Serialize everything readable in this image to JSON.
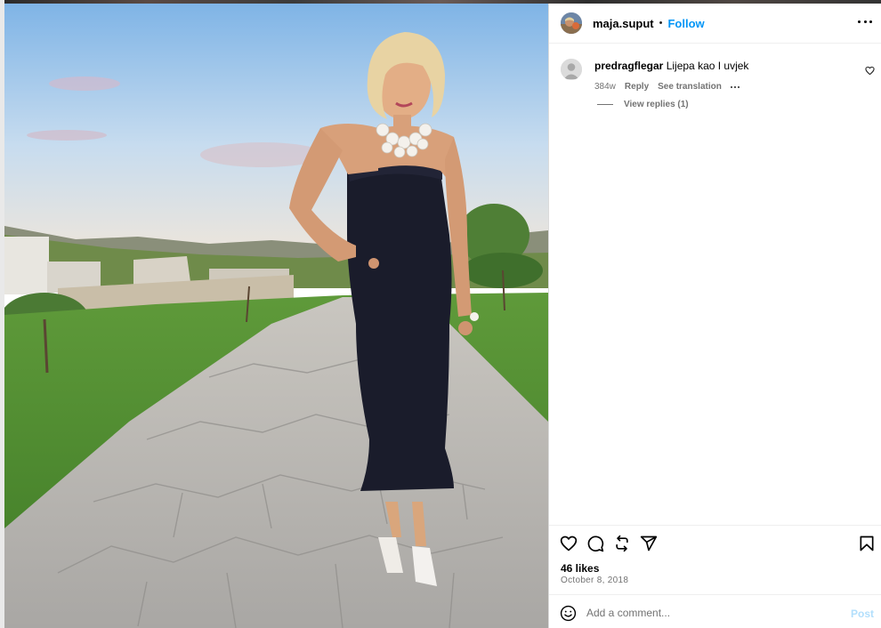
{
  "post": {
    "image_alt": "Woman in black strapless dress standing on stone path"
  },
  "header": {
    "username": "maja.suput",
    "separator": "•",
    "follow_label": "Follow",
    "more_icon": "more-horizontal-icon"
  },
  "comment": {
    "username": "predragflegar",
    "text": "Lijepa kao I uvjek",
    "age": "384w",
    "reply_label": "Reply",
    "translation_label": "See translation",
    "view_replies_label": "View replies (1)"
  },
  "actions": {
    "icons": [
      "heart-icon",
      "comment-icon",
      "repost-icon",
      "share-icon",
      "bookmark-icon"
    ],
    "likes": "46 likes",
    "date": "October 8, 2018"
  },
  "add_comment": {
    "placeholder": "Add a comment...",
    "post_label": "Post"
  },
  "colors": {
    "accent": "#0095f6",
    "post_disabled": "#b2dffc",
    "secondary_text": "#737373",
    "divider": "#efefef"
  }
}
